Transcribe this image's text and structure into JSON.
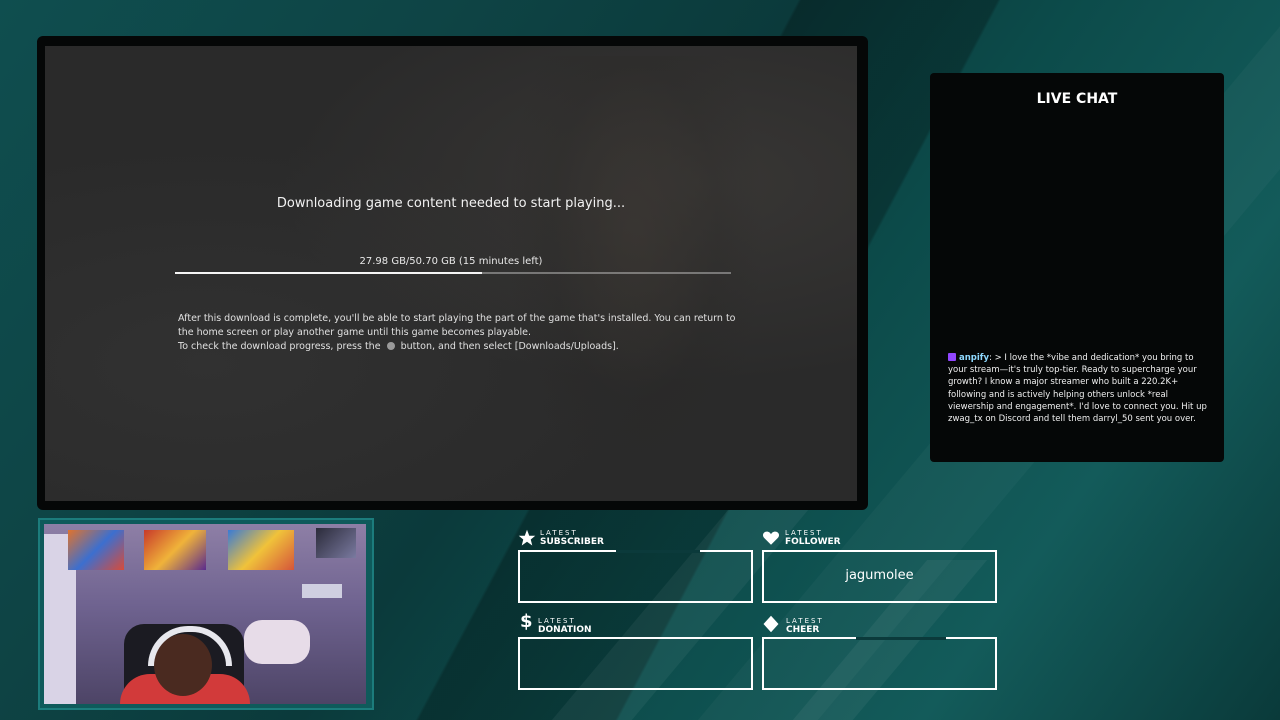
{
  "game": {
    "download_title": "Downloading game content needed to start playing...",
    "progress_text": "27.98 GB/50.70 GB (15 minutes left)",
    "progress_fraction": 0.552,
    "info_line1": "After this download is complete, you'll be able to start playing the part of the game that's installed. You can return to the home screen or play another game until this game becomes playable.",
    "info_line2_pre": "To check the download progress, press the",
    "info_line2_post": "button, and then select [Downloads/Uploads]."
  },
  "chat": {
    "title": "LIVE CHAT",
    "message_user": "anpify",
    "message_text": ": > I love the *vibe and dedication* you bring to your stream—it's truly top-tier. Ready to supercharge your growth? I know a major streamer who built a 220.2K+ following and is actively helping others unlock *real viewership and engagement*. I'd love to connect you. Hit up zwag_tx on Discord and tell them darryl_50 sent you over."
  },
  "alerts": {
    "subscriber": {
      "small": "LATEST",
      "big": "SUBSCRIBER",
      "value": ""
    },
    "follower": {
      "small": "LATEST",
      "big": "FOLLOWER",
      "value": "jagumolee"
    },
    "donation": {
      "small": "LATEST",
      "big": "DONATION",
      "value": ""
    },
    "cheer": {
      "small": "LATEST",
      "big": "CHEER",
      "value": ""
    }
  },
  "colors": {
    "background_teal": "#0b3a3b",
    "accent_teal": "#1c7c7c",
    "chat_badge": "#9146ff",
    "chat_username": "#8fd9ff"
  }
}
